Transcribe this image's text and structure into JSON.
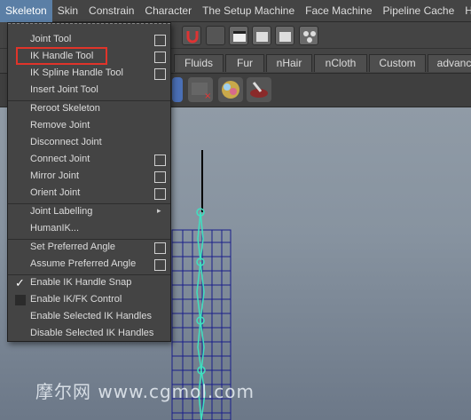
{
  "menubar": {
    "items": [
      "Skeleton",
      "Skin",
      "Constrain",
      "Character",
      "The Setup Machine",
      "Face Machine",
      "Pipeline Cache",
      "Help"
    ]
  },
  "tabs": [
    "Fluids",
    "Fur",
    "nHair",
    "nCloth",
    "Custom",
    "advanc"
  ],
  "skeleton_menu": {
    "items": [
      {
        "label": "Joint Tool",
        "option_box": true
      },
      {
        "label": "IK Handle Tool",
        "option_box": true,
        "highlighted": true
      },
      {
        "label": "IK Spline Handle Tool",
        "option_box": true
      },
      {
        "label": "Insert Joint Tool",
        "option_box": false
      },
      {
        "label": "Reroot Skeleton",
        "option_box": false
      },
      {
        "label": "Remove Joint",
        "option_box": false
      },
      {
        "label": "Disconnect Joint",
        "option_box": false
      },
      {
        "label": "Connect Joint",
        "option_box": true
      },
      {
        "label": "Mirror Joint",
        "option_box": true
      },
      {
        "label": "Orient Joint",
        "option_box": true
      },
      {
        "label": "Joint Labelling",
        "submenu": true
      },
      {
        "label": "HumanIK...",
        "option_box": false
      },
      {
        "label": "Set Preferred Angle",
        "option_box": true
      },
      {
        "label": "Assume Preferred Angle",
        "option_box": true
      },
      {
        "label": "Enable IK Handle Snap",
        "checked": true
      },
      {
        "label": "Enable IK/FK Control",
        "checked": false
      },
      {
        "label": "Enable Selected IK Handles",
        "option_box": false
      },
      {
        "label": "Disable Selected IK Handles",
        "option_box": false
      }
    ]
  },
  "annotation": {
    "color": "#e0342a"
  },
  "watermark": "摩尔网 www.cgmol.com",
  "colors": {
    "menu_bg": "#444444",
    "active_menu": "#5b7fa6",
    "ik_wire": "#3fe0c0",
    "mesh_wire": "#1a1f8a"
  }
}
